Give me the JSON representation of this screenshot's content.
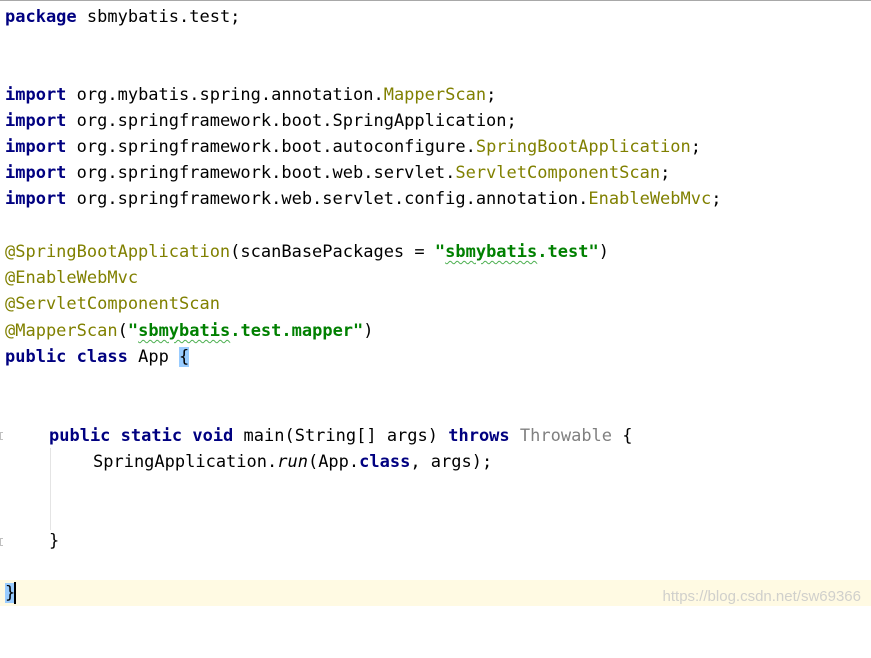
{
  "editor": {
    "lines": {
      "package": {
        "kw": "package",
        "rest": " sbmybatis.test;"
      },
      "imports": [
        {
          "kw": "import",
          "pkg": " org.mybatis.spring.annotation.",
          "cls": "MapperScan",
          "end": ";"
        },
        {
          "kw": "import",
          "pkg": " org.springframework.boot.SpringApplication",
          "cls": "",
          "end": ";"
        },
        {
          "kw": "import",
          "pkg": " org.springframework.boot.autoconfigure.",
          "cls": "SpringBootApplication",
          "end": ";"
        },
        {
          "kw": "import",
          "pkg": " org.springframework.boot.web.servlet.",
          "cls": "ServletComponentScan",
          "end": ";"
        },
        {
          "kw": "import",
          "pkg": " org.springframework.web.servlet.config.annotation.",
          "cls": "EnableWebMvc",
          "end": ";"
        }
      ],
      "ann1": {
        "name": "@SpringBootApplication",
        "open": "(scanBasePackages = ",
        "q1": "\"",
        "str": "sbmybatis",
        "strRest": ".test",
        "q2": "\"",
        "close": ")"
      },
      "ann2": {
        "name": "@EnableWebMvc"
      },
      "ann3": {
        "name": "@ServletComponentScan"
      },
      "ann4": {
        "name": "@MapperScan",
        "open": "(",
        "q1": "\"",
        "str": "sbmybatis",
        "strRest": ".test.mapper",
        "q2": "\"",
        "close": ")"
      },
      "classDecl": {
        "kw1": "public",
        "kw2": "class",
        "name": " App ",
        "brace": "{"
      },
      "mainDecl": {
        "kw1": "public",
        "kw2": "static",
        "kw3": "void",
        "sig": " main(String[] args) ",
        "kw4": "throws",
        "exc": "Throwable",
        "brace": " {"
      },
      "runCall": {
        "prefix": "SpringApplication.",
        "method": "run",
        "args1": "(App.",
        "kw": "class",
        "args2": ", args);"
      },
      "closeMain": {
        "brace": "}"
      },
      "closeClass": {
        "brace": "}"
      }
    }
  },
  "watermark": {
    "text": "https://blog.csdn.net/sw69366"
  }
}
